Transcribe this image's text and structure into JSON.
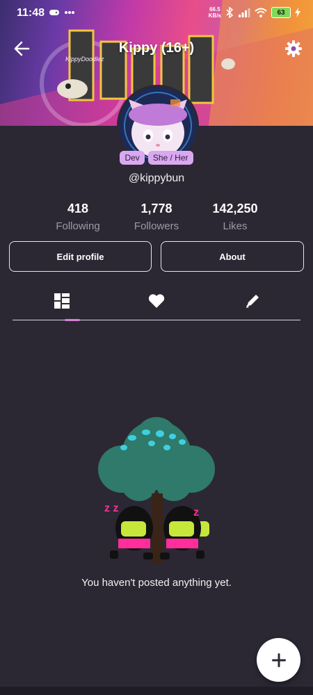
{
  "status_bar": {
    "time": "11:48",
    "network_speed_value": "66.5",
    "network_speed_unit": "KB/s",
    "battery_level": "63"
  },
  "header": {
    "title": "Kippy (16+)",
    "banner_text": "KIPPY"
  },
  "profile": {
    "badges": [
      "Dev",
      "She / Her"
    ],
    "handle": "@kippybun"
  },
  "stats": [
    {
      "value": "418",
      "label": "Following"
    },
    {
      "value": "1,778",
      "label": "Followers"
    },
    {
      "value": "142,250",
      "label": "Likes"
    }
  ],
  "buttons": {
    "edit_profile": "Edit profile",
    "about": "About"
  },
  "tabs": [
    {
      "icon": "grid-icon",
      "selected": true
    },
    {
      "icon": "heart-icon",
      "selected": false
    },
    {
      "icon": "pencil-icon",
      "selected": false
    }
  ],
  "empty_state": {
    "message": "You haven't posted anything yet."
  },
  "colors": {
    "background": "#2b2833",
    "accent": "#d87fd8",
    "badge": "#d9a8f0",
    "fab": "#ffffff"
  }
}
